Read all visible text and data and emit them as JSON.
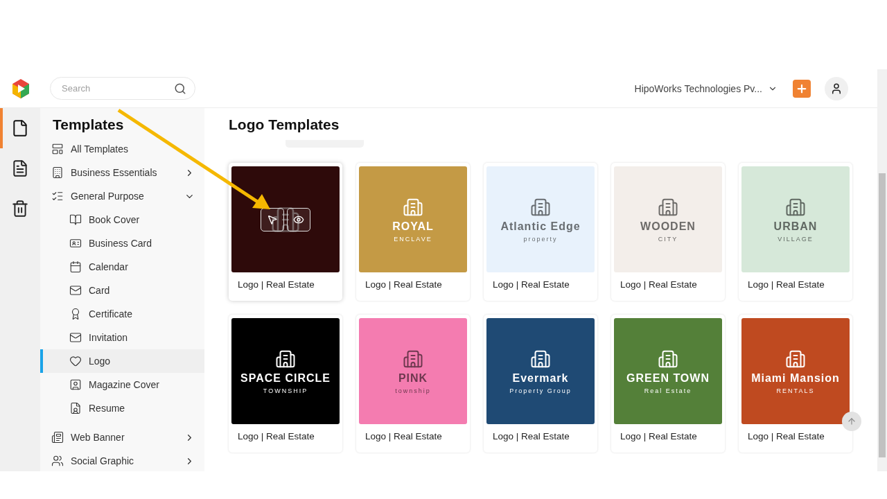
{
  "header": {
    "search": {
      "placeholder": "Search"
    },
    "organization": "HipoWorks Technologies Pv..."
  },
  "rail": [
    {
      "selected": true
    },
    {
      "selected": false
    },
    {
      "selected": false
    }
  ],
  "sidebar": {
    "title": "Templates",
    "items": [
      {
        "label": "All Templates",
        "selected": false
      },
      {
        "label": "Business Essentials",
        "selected": false,
        "expanded": false
      },
      {
        "label": "General Purpose",
        "selected": false,
        "expanded": true,
        "children": [
          {
            "label": "Book Cover",
            "selected": false
          },
          {
            "label": "Business Card",
            "selected": false
          },
          {
            "label": "Calendar",
            "selected": false
          },
          {
            "label": "Card",
            "selected": false
          },
          {
            "label": "Certificate",
            "selected": false
          },
          {
            "label": "Invitation",
            "selected": false
          },
          {
            "label": "Logo",
            "selected": true
          },
          {
            "label": "Magazine Cover",
            "selected": false
          },
          {
            "label": "Resume",
            "selected": false
          }
        ]
      },
      {
        "label": "Web Banner",
        "selected": false,
        "expanded": false
      },
      {
        "label": "Social Graphic",
        "selected": false,
        "expanded": false
      }
    ]
  },
  "main": {
    "title": "Logo Templates",
    "cards": [
      {
        "caption": "Logo | Real Estate",
        "color": "#2e0a0a",
        "hovered": true
      },
      {
        "caption": "Logo | Real Estate",
        "color": "#c49a45",
        "hovered": false,
        "logo_lines": [
          "ROYAL",
          "ENCLAVE"
        ]
      },
      {
        "caption": "Logo | Real Estate",
        "color": "#e8f2fc",
        "hovered": false,
        "logo_lines": [
          "Atlantic Edge",
          "property"
        ]
      },
      {
        "caption": "Logo | Real Estate",
        "color": "#f3eeea",
        "hovered": false,
        "logo_lines": [
          "WOODEN",
          "CITY"
        ]
      },
      {
        "caption": "Logo | Real Estate",
        "color": "#d6e8d9",
        "hovered": false,
        "logo_lines": [
          "URBAN",
          "VILLAGE"
        ]
      },
      {
        "caption": "Logo | Real Estate",
        "color": "#000000",
        "hovered": false,
        "logo_lines": [
          "SPACE CIRCLE",
          "TOWNSHIP"
        ]
      },
      {
        "caption": "Logo | Real Estate",
        "color": "#f47cb0",
        "hovered": false,
        "logo_lines": [
          "PINK",
          "township"
        ]
      },
      {
        "caption": "Logo | Real Estate",
        "color": "#1f4a74",
        "hovered": false,
        "logo_lines": [
          "Evermark",
          "Property Group"
        ]
      },
      {
        "caption": "Logo | Real Estate",
        "color": "#548039",
        "hovered": false,
        "logo_lines": [
          "GREEN TOWN",
          "Real Estate"
        ]
      },
      {
        "caption": "Logo | Real Estate",
        "color": "#bf4a20",
        "hovered": false,
        "logo_lines": [
          "Miami Mansion",
          "RENTALS"
        ]
      }
    ]
  }
}
